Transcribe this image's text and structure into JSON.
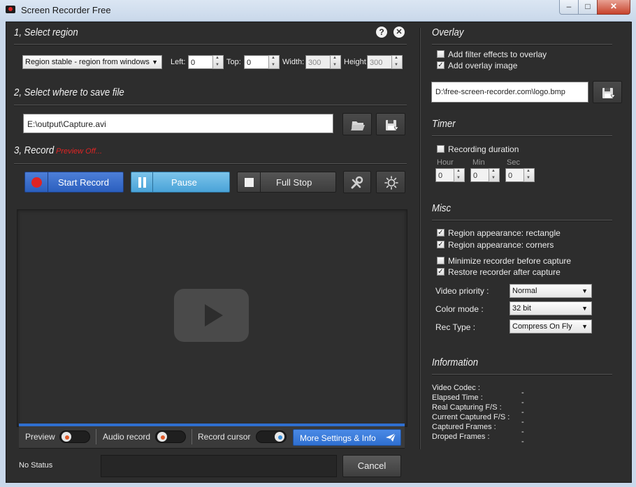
{
  "window": {
    "title": "Screen Recorder Free",
    "minimize": "–",
    "maximize": "□",
    "close": "✕"
  },
  "region": {
    "title": "1, Select region",
    "mode": "Region stable - region from windows",
    "left_label": "Left:",
    "left_value": "0",
    "top_label": "Top:",
    "top_value": "0",
    "width_label": "Width:",
    "width_value": "300",
    "height_label": "Height",
    "height_value": "300"
  },
  "save": {
    "title": "2, Select where to save file",
    "path": "E:\\output\\Capture.avi"
  },
  "record": {
    "title": "3, Record",
    "preview_status": "Preview Off...",
    "start_label": "Start Record",
    "pause_label": "Pause",
    "stop_label": "Full Stop"
  },
  "bottom_bar": {
    "preview_label": "Preview",
    "audio_label": "Audio record",
    "cursor_label": "Record cursor",
    "more_label": "More Settings & Info"
  },
  "status": {
    "text": "No Status",
    "cancel_label": "Cancel"
  },
  "overlay": {
    "title": "Overlay",
    "filter_label": "Add filter effects to overlay",
    "filter_checked": false,
    "image_label": "Add overlay image",
    "image_checked": true,
    "image_path": "D:\\free-screen-recorder.com\\logo.bmp"
  },
  "timer": {
    "title": "Timer",
    "duration_label": "Recording duration",
    "duration_checked": false,
    "hour_label": "Hour",
    "hour_value": "0",
    "min_label": "Min",
    "min_value": "0",
    "sec_label": "Sec",
    "sec_value": "0"
  },
  "misc": {
    "title": "Misc",
    "items": [
      {
        "label": "Region appearance: rectangle",
        "checked": true
      },
      {
        "label": "Region appearance: corners",
        "checked": true
      },
      {
        "label": "Minimize recorder before capture",
        "checked": false
      },
      {
        "label": "Restore recorder after capture",
        "checked": true
      }
    ],
    "priority_label": "Video priority :",
    "priority_value": "Normal",
    "color_label": "Color mode :",
    "color_value": "32 bit",
    "rectype_label": "Rec Type :",
    "rectype_value": "Compress On Fly"
  },
  "information": {
    "title": "Information",
    "rows": [
      {
        "label": "Video Codec :",
        "value": ""
      },
      {
        "label": "Elapsed Time :",
        "value": "-"
      },
      {
        "label": "Real Capturing F/S :",
        "value": "-"
      },
      {
        "label": "Current Captured F/S :",
        "value": "-"
      },
      {
        "label": "Captured Frames :",
        "value": "-"
      },
      {
        "label": "Droped Frames :",
        "value": "-"
      }
    ],
    "trailing_dash": "-"
  },
  "colors": {
    "accent_blue": "#2f6fd0",
    "record_red": "#e02424",
    "pause_blue": "#4aa3d8",
    "preview_red": "#e02424"
  }
}
